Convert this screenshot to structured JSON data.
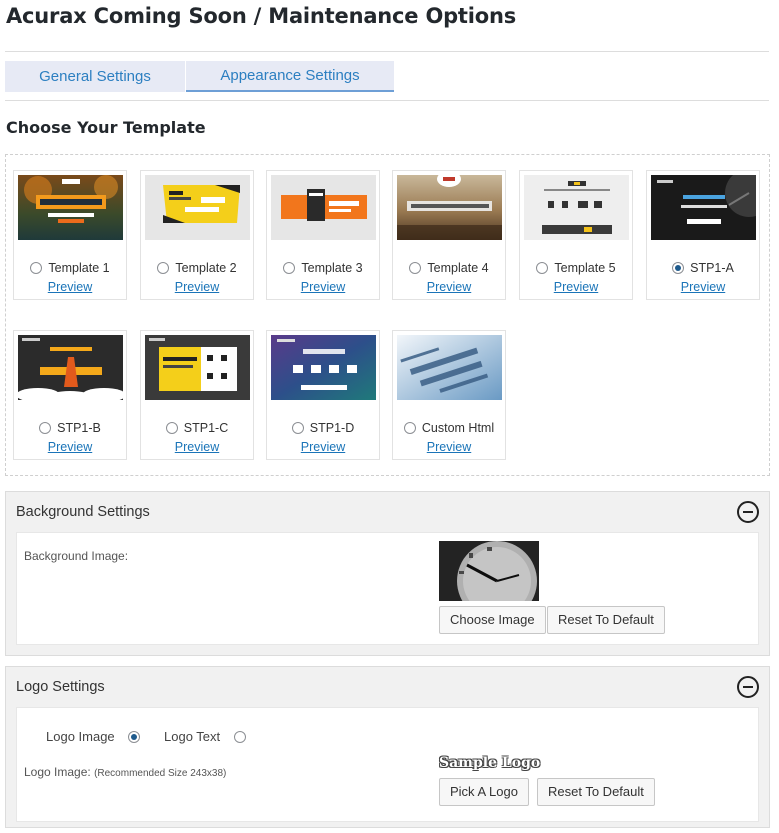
{
  "page": {
    "title": "Acurax Coming Soon / Maintenance Options"
  },
  "tabs": {
    "general": "General Settings",
    "appearance": "Appearance Settings"
  },
  "templates": {
    "heading": "Choose Your Template",
    "preview_label": "Preview",
    "items": [
      {
        "label": "Template 1",
        "selected": false
      },
      {
        "label": "Template 2",
        "selected": false
      },
      {
        "label": "Template 3",
        "selected": false
      },
      {
        "label": "Template 4",
        "selected": false
      },
      {
        "label": "Template 5",
        "selected": false
      },
      {
        "label": "STP1-A",
        "selected": true
      },
      {
        "label": "STP1-B",
        "selected": false
      },
      {
        "label": "STP1-C",
        "selected": false
      },
      {
        "label": "STP1-D",
        "selected": false
      },
      {
        "label": "Custom Html",
        "selected": false
      }
    ]
  },
  "background": {
    "title": "Background Settings",
    "image_label": "Background Image:",
    "choose_button": "Choose Image",
    "reset_button": "Reset To Default"
  },
  "logo": {
    "title": "Logo Settings",
    "option_image": "Logo Image",
    "option_text": "Logo Text",
    "selected_option": "Logo Image",
    "image_label": "Logo Image:",
    "image_note": "(Recommended Size 243x38)",
    "sample_logo": "Sample Logo",
    "pick_button": "Pick A Logo",
    "reset_button": "Reset To Default"
  },
  "colors": {
    "accent": "#2c7fc1",
    "tab_bg": "#e7eaf5",
    "panel_bg": "#f1f1f1"
  }
}
